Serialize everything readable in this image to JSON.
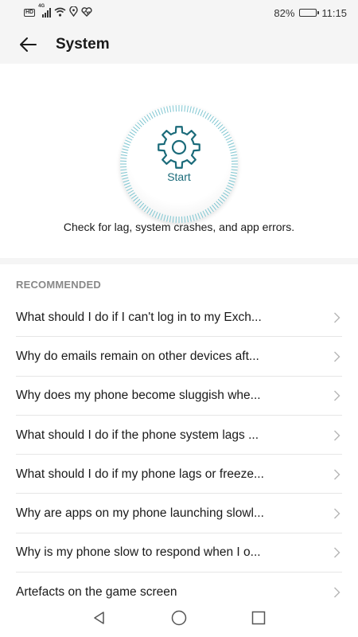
{
  "status_bar": {
    "hd_label": "HD",
    "network_label": "4G",
    "battery_percent": "82%",
    "battery_level": 0.82,
    "time": "11:15",
    "icons": [
      "hd-icon",
      "signal-icon",
      "wifi-icon",
      "location-icon",
      "health-icon",
      "battery-icon"
    ]
  },
  "app_bar": {
    "title": "System",
    "back_icon": "arrow-left-icon"
  },
  "diagnostic": {
    "start_label": "Start",
    "icon": "gear-icon",
    "description": "Check for lag, system crashes, and app errors."
  },
  "recommended": {
    "heading": "RECOMMENDED",
    "items": [
      {
        "label": "What should I do if I can't log in to my Exch..."
      },
      {
        "label": "Why do emails remain on other devices aft..."
      },
      {
        "label": "Why does my phone become sluggish whe..."
      },
      {
        "label": "What should I do if the phone system lags ..."
      },
      {
        "label": "What should I do if my phone lags or freeze..."
      },
      {
        "label": "Why are apps on my phone launching slowl..."
      },
      {
        "label": "Why is my phone slow to respond when I o..."
      },
      {
        "label": "Artefacts on the game screen"
      }
    ]
  },
  "nav_bar": {
    "icons": [
      "back-triangle-icon",
      "home-circle-icon",
      "recents-square-icon"
    ]
  },
  "colors": {
    "accent": "#1b6b7a",
    "dial_tick": "#7fc6d1",
    "background": "#f5f5f5"
  }
}
